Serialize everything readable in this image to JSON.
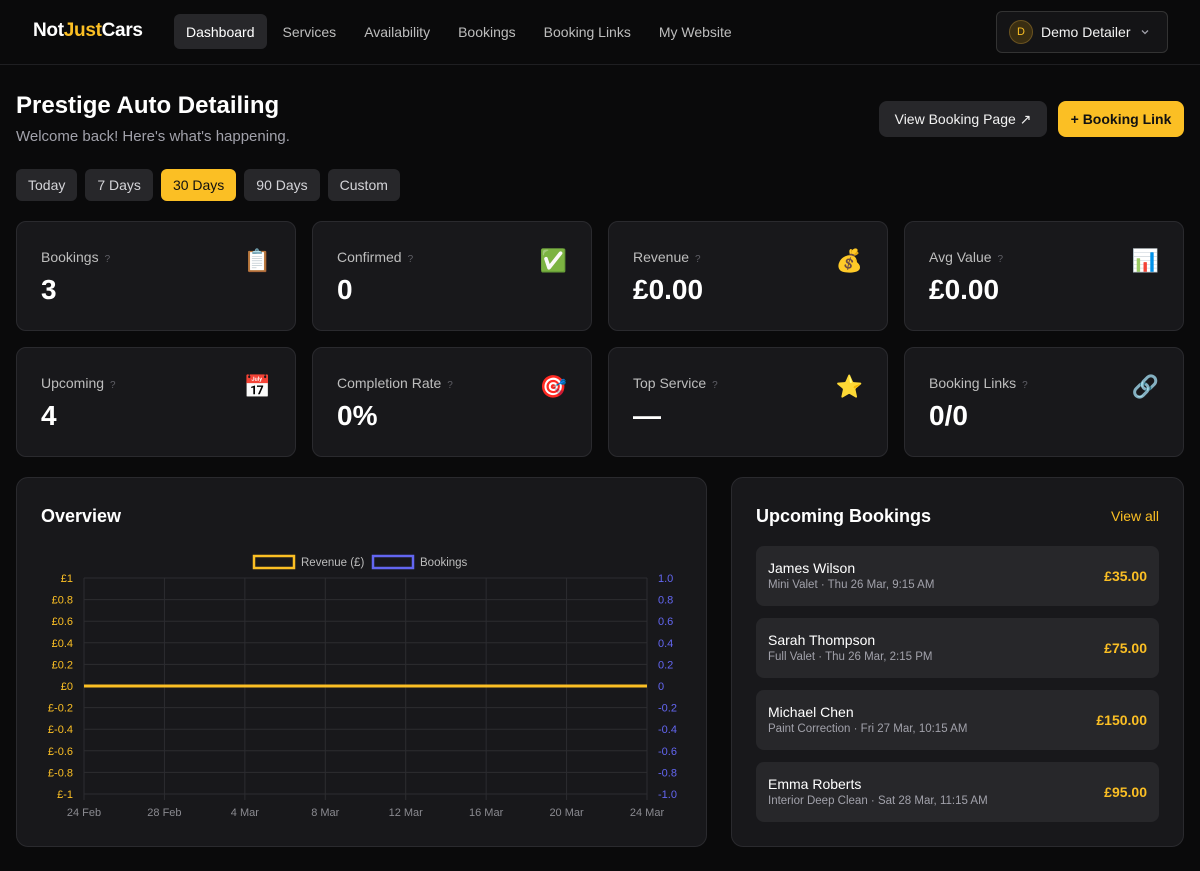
{
  "brand": {
    "part1": "Not",
    "part2": "Just",
    "part3": "Cars"
  },
  "nav": {
    "items": [
      {
        "label": "Dashboard",
        "active": true
      },
      {
        "label": "Services"
      },
      {
        "label": "Availability"
      },
      {
        "label": "Bookings"
      },
      {
        "label": "Booking Links"
      },
      {
        "label": "My Website"
      }
    ],
    "user": {
      "initial": "D",
      "name": "Demo Detailer"
    }
  },
  "header": {
    "title": "Prestige Auto Detailing",
    "subtitle": "Welcome back! Here's what's happening.",
    "view_booking_label": "View Booking Page ↗",
    "add_link_label": "+ Booking Link"
  },
  "ranges": [
    {
      "label": "Today"
    },
    {
      "label": "7 Days"
    },
    {
      "label": "30 Days",
      "active": true
    },
    {
      "label": "90 Days"
    },
    {
      "label": "Custom"
    }
  ],
  "stats": [
    {
      "label": "Bookings",
      "value": "3",
      "icon": "📋",
      "icon_name": "clipboard-icon"
    },
    {
      "label": "Confirmed",
      "value": "0",
      "icon": "✅",
      "icon_name": "check-icon"
    },
    {
      "label": "Revenue",
      "value": "£0.00",
      "icon": "💰",
      "icon_name": "money-bag-icon"
    },
    {
      "label": "Avg Value",
      "value": "£0.00",
      "icon": "📊",
      "icon_name": "bar-chart-icon"
    },
    {
      "label": "Upcoming",
      "value": "4",
      "icon": "📅",
      "icon_name": "calendar-icon"
    },
    {
      "label": "Completion Rate",
      "value": "0%",
      "icon": "🎯",
      "icon_name": "target-icon"
    },
    {
      "label": "Top Service",
      "value": "—",
      "icon": "⭐",
      "icon_name": "star-icon"
    },
    {
      "label": "Booking Links",
      "value": "0/0",
      "icon": "🔗",
      "icon_name": "link-icon"
    }
  ],
  "stat_help": "?",
  "overview": {
    "title": "Overview"
  },
  "chart_data": {
    "type": "line",
    "x": [
      "24 Feb",
      "28 Feb",
      "4 Mar",
      "8 Mar",
      "12 Mar",
      "16 Mar",
      "20 Mar",
      "24 Mar"
    ],
    "series": [
      {
        "name": "Revenue (£)",
        "axis": "left",
        "color": "#fbbf24",
        "values": [
          0,
          0,
          0,
          0,
          0,
          0,
          0,
          0
        ]
      },
      {
        "name": "Bookings",
        "axis": "right",
        "color": "#6366f1",
        "values": [
          0,
          0,
          0,
          0,
          0,
          0,
          0,
          0
        ]
      }
    ],
    "y_left": {
      "range": [
        -1,
        1
      ],
      "ticks": [
        "£1",
        "£0.8",
        "£0.6",
        "£0.4",
        "£0.2",
        "£0",
        "£-0.2",
        "£-0.4",
        "£-0.6",
        "£-0.8",
        "£-1"
      ]
    },
    "y_right": {
      "range": [
        -1,
        1
      ],
      "ticks": [
        "1.0",
        "0.8",
        "0.6",
        "0.4",
        "0.2",
        "0",
        "-0.2",
        "-0.4",
        "-0.6",
        "-0.8",
        "-1.0"
      ]
    },
    "grid": true,
    "legend": "top-center"
  },
  "upcoming": {
    "title": "Upcoming Bookings",
    "view_all": "View all",
    "items": [
      {
        "name": "James Wilson",
        "detail": "Mini Valet · Thu 26 Mar, 9:15 AM",
        "price": "£35.00"
      },
      {
        "name": "Sarah Thompson",
        "detail": "Full Valet · Thu 26 Mar, 2:15 PM",
        "price": "£75.00"
      },
      {
        "name": "Michael Chen",
        "detail": "Paint Correction · Fri 27 Mar, 10:15 AM",
        "price": "£150.00"
      },
      {
        "name": "Emma Roberts",
        "detail": "Interior Deep Clean · Sat 28 Mar, 11:15 AM",
        "price": "£95.00"
      }
    ]
  }
}
